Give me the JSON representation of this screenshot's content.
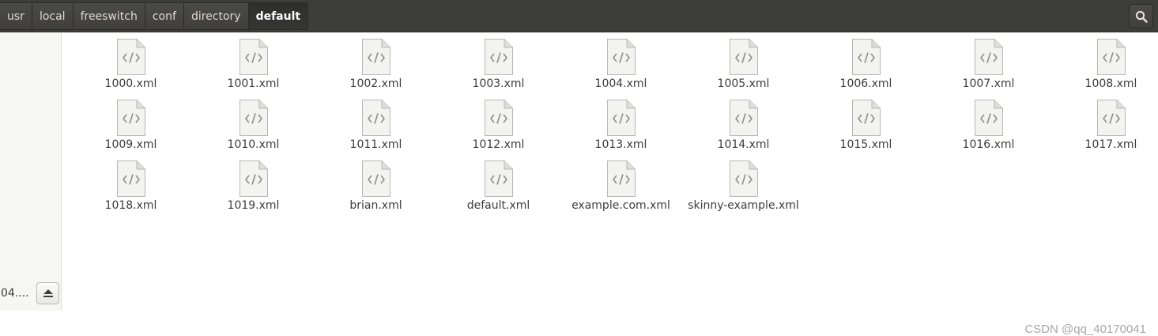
{
  "breadcrumb": {
    "items": [
      "usr",
      "local",
      "freeswitch",
      "conf",
      "directory",
      "default"
    ]
  },
  "toolbar": {
    "search_icon": "search-icon"
  },
  "sidebar": {
    "device_label": "04...."
  },
  "files": [
    "1000.xml",
    "1001.xml",
    "1002.xml",
    "1003.xml",
    "1004.xml",
    "1005.xml",
    "1006.xml",
    "1007.xml",
    "1008.xml",
    "1009.xml",
    "1010.xml",
    "1011.xml",
    "1012.xml",
    "1013.xml",
    "1014.xml",
    "1015.xml",
    "1016.xml",
    "1017.xml",
    "1018.xml",
    "1019.xml",
    "brian.xml",
    "default.xml",
    "example.com.xml",
    "skinny-example.xml"
  ],
  "watermark": "CSDN @qq_40170041",
  "colors": {
    "topbar": "#3d3d3a",
    "active_crumb": "#2e2e2c",
    "sidebar": "#f6f6f5"
  }
}
